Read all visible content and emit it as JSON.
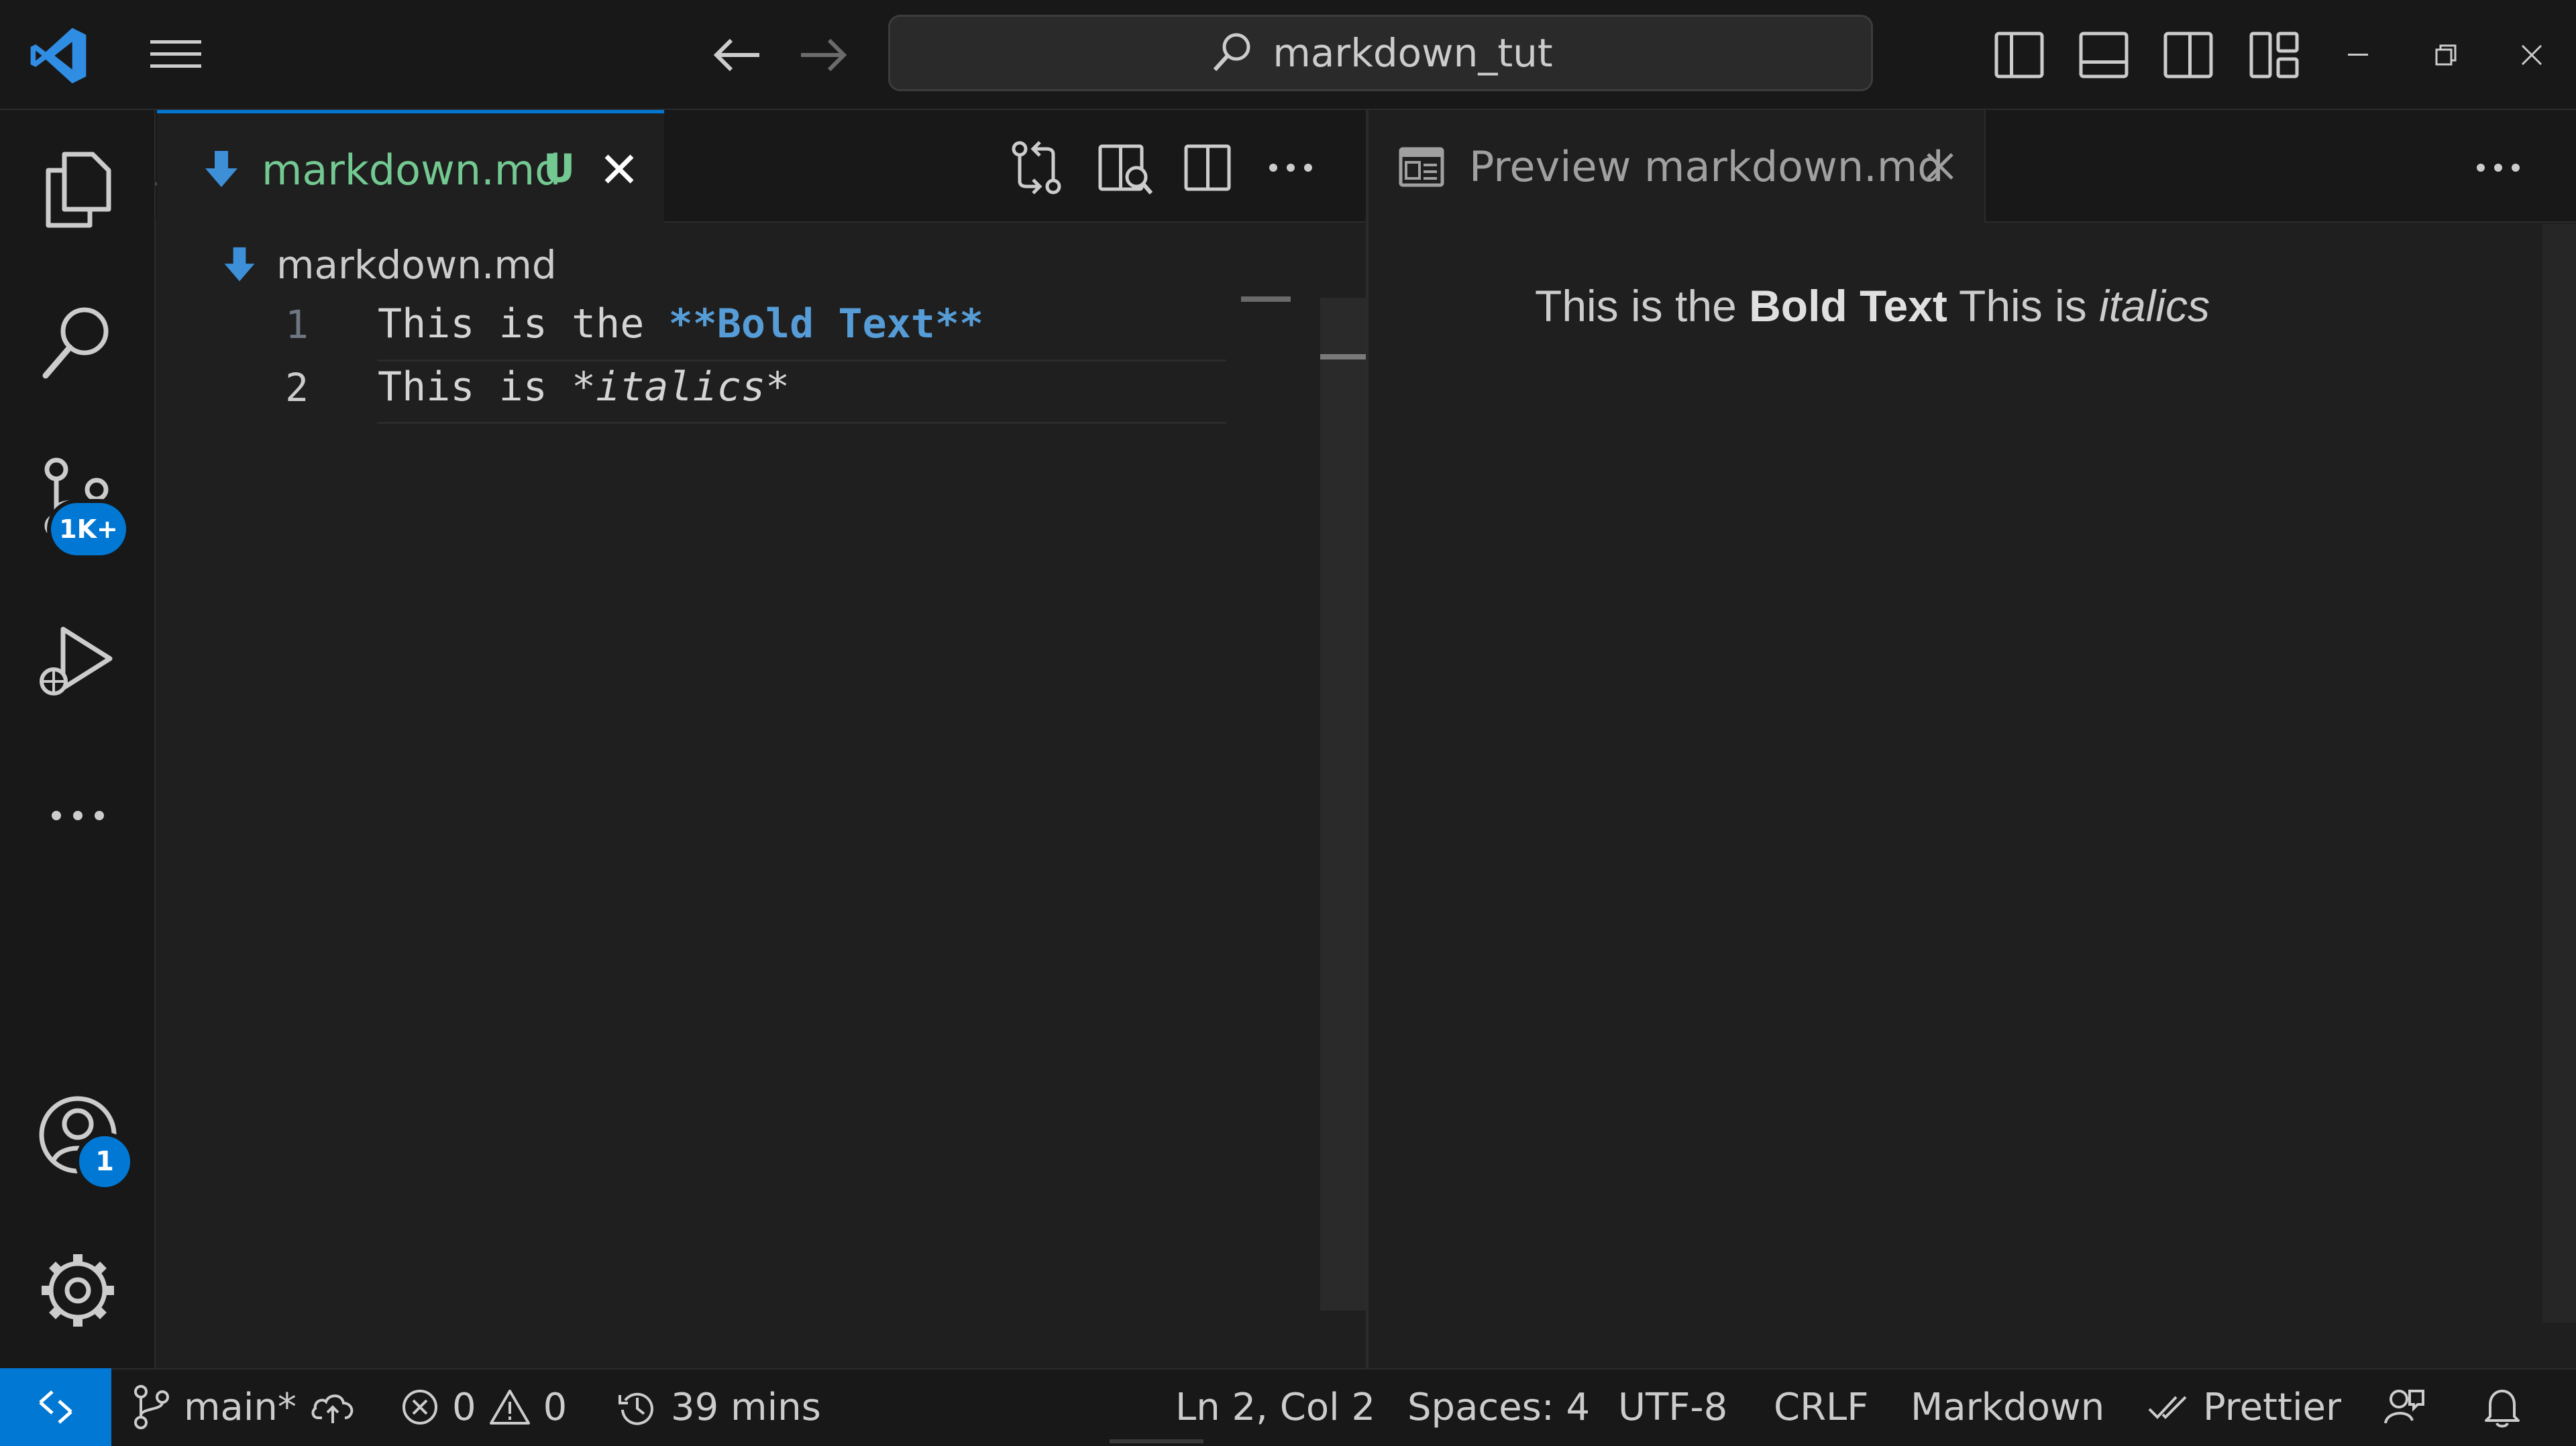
{
  "titlebar": {
    "search_text": "markdown_tut"
  },
  "activity_bar": {
    "source_control_badge": "1K+",
    "accounts_badge": "1"
  },
  "editor_left": {
    "tab": {
      "label": "markdown.md",
      "status": "U"
    },
    "breadcrumb": "markdown.md",
    "lines": [
      {
        "number": "1",
        "plain": "This is the ",
        "bold": "**Bold Text**"
      },
      {
        "number": "2",
        "plain": "This is ",
        "italic": "*italics*"
      }
    ]
  },
  "editor_right": {
    "tab": {
      "label": "Preview markdown.md"
    },
    "preview": {
      "part1": "This is the ",
      "bold": "Bold Text",
      "part2": " This is ",
      "italic": "italics"
    }
  },
  "statusbar": {
    "branch": "main*",
    "errors": "0",
    "warnings": "0",
    "time": "39 mins",
    "cursor": "Ln 2, Col 2",
    "spaces": "Spaces: 4",
    "encoding": "UTF-8",
    "eol": "CRLF",
    "language": "Markdown",
    "formatter": "Prettier"
  },
  "colors": {
    "accent": "#0078d4",
    "untracked": "#73c991",
    "md_bold": "#569cd6"
  }
}
